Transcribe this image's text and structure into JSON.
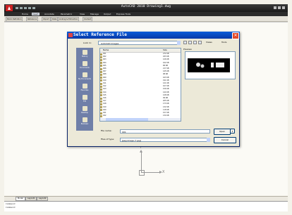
{
  "app": {
    "title": "AutoCAD 2010  Drawing1.dwg"
  },
  "ribbon": {
    "tabs": [
      "Home",
      "Insert",
      "Annotate",
      "Parametric",
      "View",
      "Manage",
      "Output",
      "Express Tools",
      ""
    ],
    "active": "Insert"
  },
  "file_tabs": [
    "Block Definition",
    "Reference",
    "Import",
    "Data",
    "Linking & Extraction",
    "Content"
  ],
  "dialog": {
    "title": "Select Reference File",
    "look_in_label": "Look in:",
    "look_in_value": "AutoCAD Images",
    "views_label": "Views",
    "tools_label": "Tools",
    "places": [
      "History",
      "Documents",
      "My Documents",
      "Favorites",
      "FTP",
      "Desktop",
      "Buzzsaw"
    ],
    "columns": {
      "name": "Name",
      "size": "Size"
    },
    "files": [
      {
        "name": "001",
        "size": "272 KB"
      },
      {
        "name": "002",
        "size": "183 KB"
      },
      {
        "name": "003",
        "size": "126 KB"
      },
      {
        "name": "004",
        "size": "162 KB"
      },
      {
        "name": "005",
        "size": "68 KB"
      },
      {
        "name": "006",
        "size": "217 KB"
      },
      {
        "name": "007",
        "size": "145 KB"
      },
      {
        "name": "008",
        "size": "98 KB"
      },
      {
        "name": "009",
        "size": "163 KB"
      },
      {
        "name": "010",
        "size": "191 KB"
      },
      {
        "name": "011",
        "size": "121 KB"
      },
      {
        "name": "012",
        "size": "107 KB"
      },
      {
        "name": "013",
        "size": "156 KB"
      },
      {
        "name": "014",
        "size": "144 KB"
      },
      {
        "name": "015",
        "size": "128 KB"
      },
      {
        "name": "016",
        "size": "99 KB"
      },
      {
        "name": "017",
        "size": "205 KB"
      },
      {
        "name": "018",
        "size": "173 KB"
      },
      {
        "name": "019",
        "size": "132 KB"
      },
      {
        "name": "020",
        "size": "118 KB"
      },
      {
        "name": "021",
        "size": "157 KB"
      },
      {
        "name": "022",
        "size": "134 KB"
      }
    ],
    "preview_label": "Preview",
    "file_name_label": "File name:",
    "file_name_value": "001",
    "file_type_label": "Files of type:",
    "file_type_value": "Jpeg Image (*.jpg)",
    "open_label": "Open",
    "cancel_label": "Cancel"
  },
  "ucs": {
    "y": "Y",
    "x": "X"
  },
  "layout_tabs": [
    "Model",
    "Layout1",
    "Layout2"
  ],
  "command": {
    "line1": "Command:",
    "line2": "Command:"
  }
}
